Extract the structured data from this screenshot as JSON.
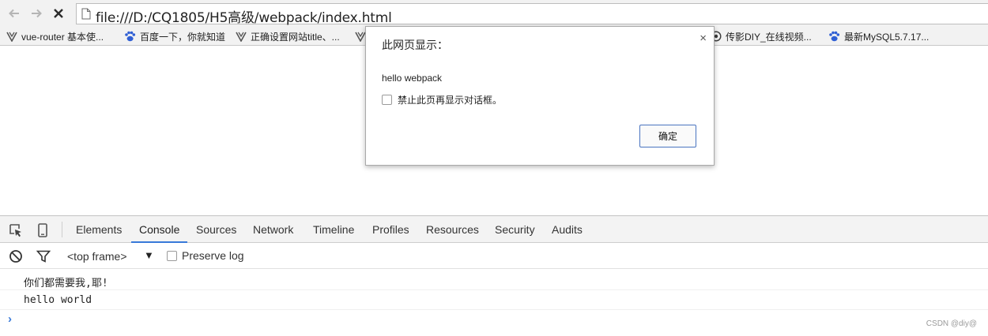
{
  "browser": {
    "url": "file:///D:/CQ1805/H5高级/webpack/index.html",
    "nav_icons": [
      "back-arrow-icon",
      "forward-arrow-icon",
      "stop-icon",
      "page-icon"
    ]
  },
  "bookmarks": [
    {
      "label": "vue-router 基本使...",
      "icon": "vue-logo-icon"
    },
    {
      "label": "百度一下，你就知道",
      "icon": "baidu-paw-icon"
    },
    {
      "label": "正确设置网站title、...",
      "icon": "vue-logo-icon"
    },
    {
      "label": "",
      "icon": "vue-logo-icon"
    },
    {
      "label": "传影DIY_在线视频...",
      "icon": "globe-icon"
    },
    {
      "label": "最新MySQL5.7.17...",
      "icon": "baidu-paw-icon"
    }
  ],
  "dialog": {
    "title": "此网页显示：",
    "message": "hello webpack",
    "checkbox_label": "禁止此页再显示对话框。",
    "ok_label": "确定",
    "close_glyph": "×"
  },
  "devtools": {
    "tabs": [
      "Elements",
      "Console",
      "Sources",
      "Network",
      "Timeline",
      "Profiles",
      "Resources",
      "Security",
      "Audits"
    ],
    "active_tab": "Console",
    "frame_selector": "<top frame>",
    "frame_arrow": "▼",
    "preserve_log_label": "Preserve log",
    "log_lines": [
      "你们都需要我,耶!",
      "hello world"
    ],
    "prompt_glyph": "›"
  },
  "watermark": "CSDN @diy@",
  "colors": {
    "accent": "#3879d9",
    "dialog_button_border": "#4a74c0"
  }
}
